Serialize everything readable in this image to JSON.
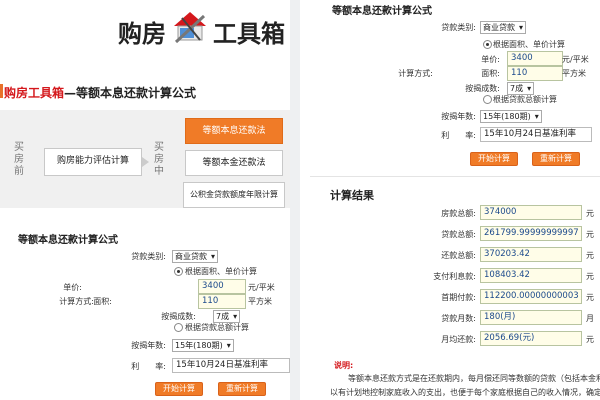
{
  "header": {
    "logo_text_left": "购房",
    "logo_text_right": "工具箱",
    "icon": "house-tools-icon"
  },
  "title": {
    "red": "购房工具箱",
    "rest": "—等额本息还款计算公式"
  },
  "flow": {
    "stage1": "买房前",
    "stage2": "买房中",
    "assess": "购房能力评估计算",
    "buttons": [
      "等额本息还款法",
      "等额本金还款法",
      "公积金贷款额度年限计算"
    ]
  },
  "form_left": {
    "heading": "等额本息还款计算公式",
    "loan_type_label": "贷款类别:",
    "loan_type_value": "商业贷款",
    "option_area": "根据面积、单价计算",
    "calc_method_label": "计算方式:",
    "price_label": "单价:",
    "price_value": "3400",
    "price_unit": "元/平米",
    "area_label": "面积:",
    "area_value": "110",
    "area_unit": "平方米",
    "ratio_label": "按揭成数:",
    "ratio_value": "7成",
    "option_total": "根据贷款总额计算",
    "years_label": "按揭年数:",
    "years_value": "15年(180期)",
    "rate_label": "利　　率:",
    "rate_value": "15年10月24日基准利率",
    "btn_calc": "开始计算",
    "btn_reset": "重新计算"
  },
  "form_right": {
    "heading": "等额本息还款计算公式",
    "loan_type_label": "贷款类别:",
    "loan_type_value": "商业贷款",
    "option_area": "根据面积、单价计算",
    "calc_method_label": "计算方式:",
    "price_label": "单价:",
    "price_value": "3400",
    "price_unit": "元/平米",
    "area_label": "面积:",
    "area_value": "110",
    "area_unit": "平方米",
    "ratio_label": "按揭成数:",
    "ratio_value": "7成",
    "option_total": "根据贷款总额计算",
    "years_label": "按揭年数:",
    "years_value": "15年(180期)",
    "rate_label": "利　　率:",
    "rate_value": "15年10月24日基准利率",
    "btn_calc": "开始计算",
    "btn_reset": "重新计算"
  },
  "results": {
    "heading": "计算结果",
    "rows": [
      {
        "label": "房款总额:",
        "value": "374000",
        "unit": "元"
      },
      {
        "label": "贷款总额:",
        "value": "261799.99999999997",
        "unit": "元"
      },
      {
        "label": "还款总额:",
        "value": "370203.42",
        "unit": "元"
      },
      {
        "label": "支付利息款:",
        "value": "108403.42",
        "unit": "元"
      },
      {
        "label": "首期付款:",
        "value": "112200.00000000003",
        "unit": "元"
      },
      {
        "label": "贷款月数:",
        "value": "180(月)",
        "unit": "月"
      },
      {
        "label": "月均还款:",
        "value": "2056.69(元)",
        "unit": "元"
      }
    ]
  },
  "note": {
    "title": "说明:",
    "line1": "等额本息还款方式是在还款期内，每月偿还同等数额的贷款（包括本金和",
    "line2": "以有计划地控制家庭收入的支出，也便于每个家庭根据自己的收入情况，确定"
  },
  "colors": {
    "accent": "#f07b27",
    "title_red": "#d4181c"
  }
}
